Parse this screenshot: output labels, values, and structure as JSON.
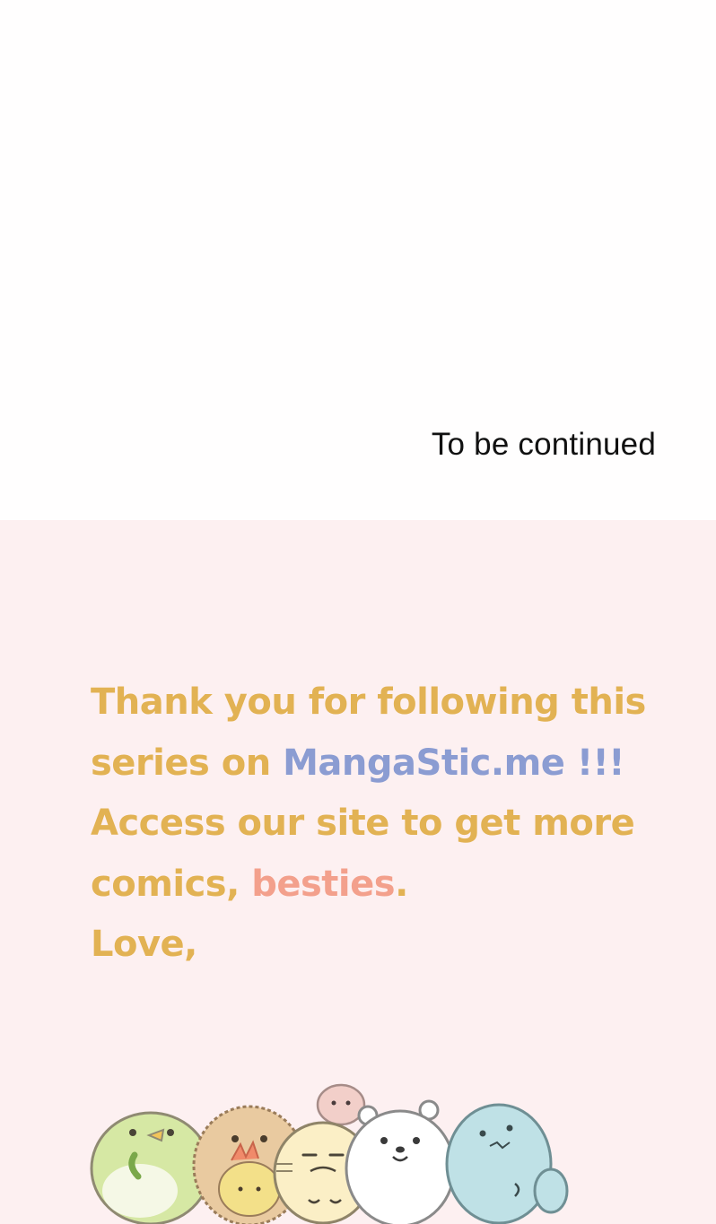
{
  "page": {
    "continued_text": "To be continued"
  },
  "thanks_card": {
    "line1": "Thank you for following this",
    "line2_prefix": "series on ",
    "site_name": "MangaStic.me",
    "line2_suffix": " !!!",
    "line3": "Access our site to get more",
    "line4_prefix": "comics, ",
    "besties": "besties",
    "line4_suffix": ".",
    "line5": "Love,",
    "colors": {
      "background": "#fdf0f1",
      "text": "#e2b253",
      "site_name": "#8b9cd2",
      "besties": "#f3a08c"
    },
    "illustration": "cute-mascot-characters"
  }
}
